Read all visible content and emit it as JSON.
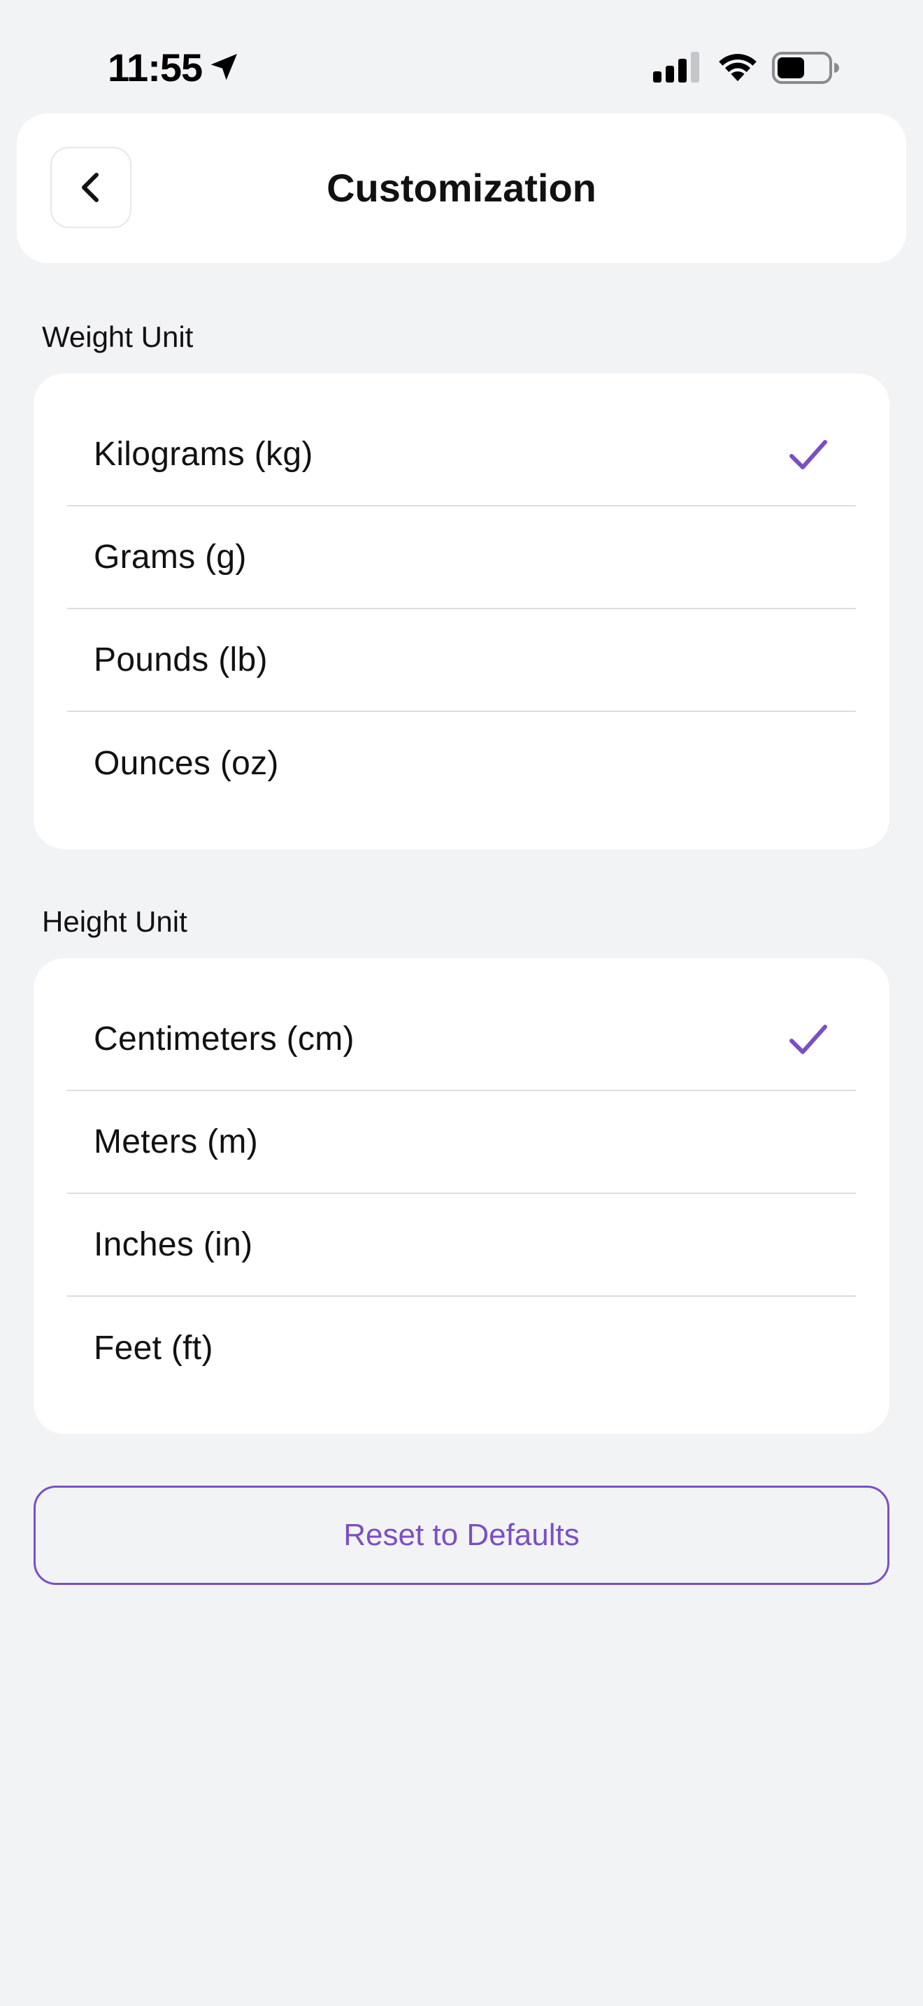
{
  "status_bar": {
    "time": "11:55"
  },
  "header": {
    "title": "Customization",
    "back_icon": "chevron-left-icon"
  },
  "weight_section": {
    "label": "Weight Unit",
    "options": [
      {
        "label": "Kilograms (kg)",
        "selected": true
      },
      {
        "label": "Grams (g)",
        "selected": false
      },
      {
        "label": "Pounds (lb)",
        "selected": false
      },
      {
        "label": "Ounces (oz)",
        "selected": false
      }
    ]
  },
  "height_section": {
    "label": "Height Unit",
    "options": [
      {
        "label": "Centimeters (cm)",
        "selected": true
      },
      {
        "label": "Meters (m)",
        "selected": false
      },
      {
        "label": "Inches (in)",
        "selected": false
      },
      {
        "label": "Feet (ft)",
        "selected": false
      }
    ]
  },
  "reset_button": {
    "label": "Reset to Defaults"
  },
  "colors": {
    "accent": "#7b4fc4",
    "background": "#f2f3f5",
    "card": "#ffffff",
    "divider": "#dcdde0"
  }
}
